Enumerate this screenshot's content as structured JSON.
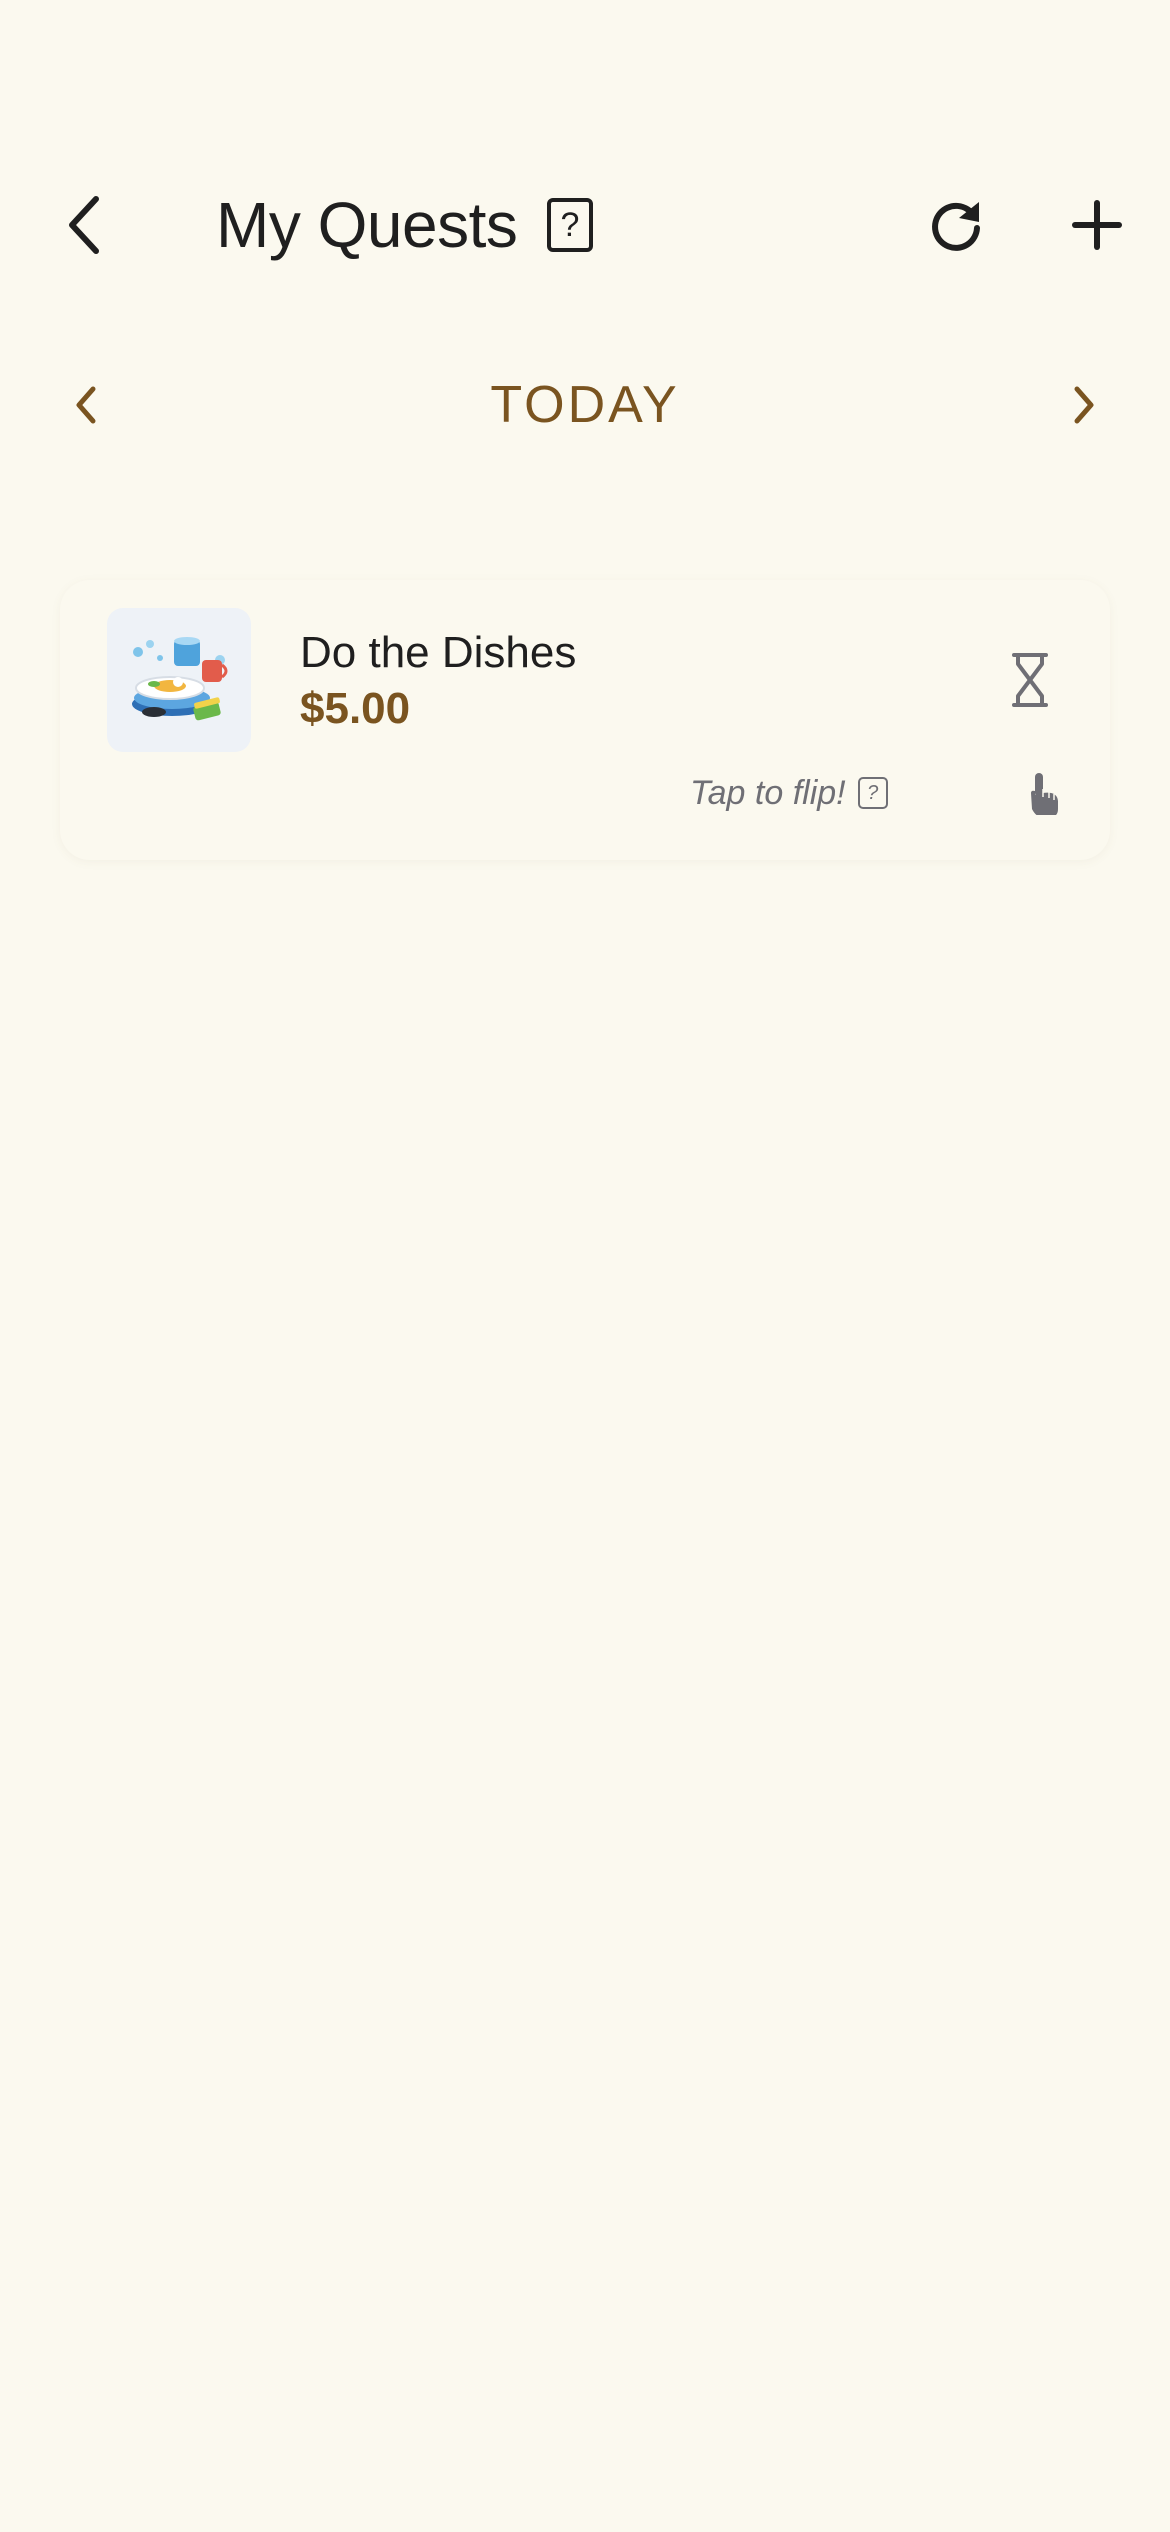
{
  "header": {
    "title": "My Quests",
    "help_label": "?",
    "back_icon": "chevron-left-icon",
    "refresh_icon": "refresh-icon",
    "add_icon": "plus-icon"
  },
  "day_nav": {
    "label": "TODAY",
    "prev_icon": "chevron-left-icon",
    "next_icon": "chevron-right-icon"
  },
  "quests": [
    {
      "name": "Do the Dishes",
      "reward": "$5.00",
      "thumbnail_icon": "dishes-icon",
      "status_icon": "hourglass-icon",
      "flip_hint": "Tap to flip!",
      "flip_help_label": "?",
      "tap_icon": "tap-hand-icon"
    }
  ],
  "colors": {
    "background": "#FBF9EF",
    "accent": "#7A5420",
    "text": "#1F1F1F",
    "muted": "#6F6F75"
  }
}
